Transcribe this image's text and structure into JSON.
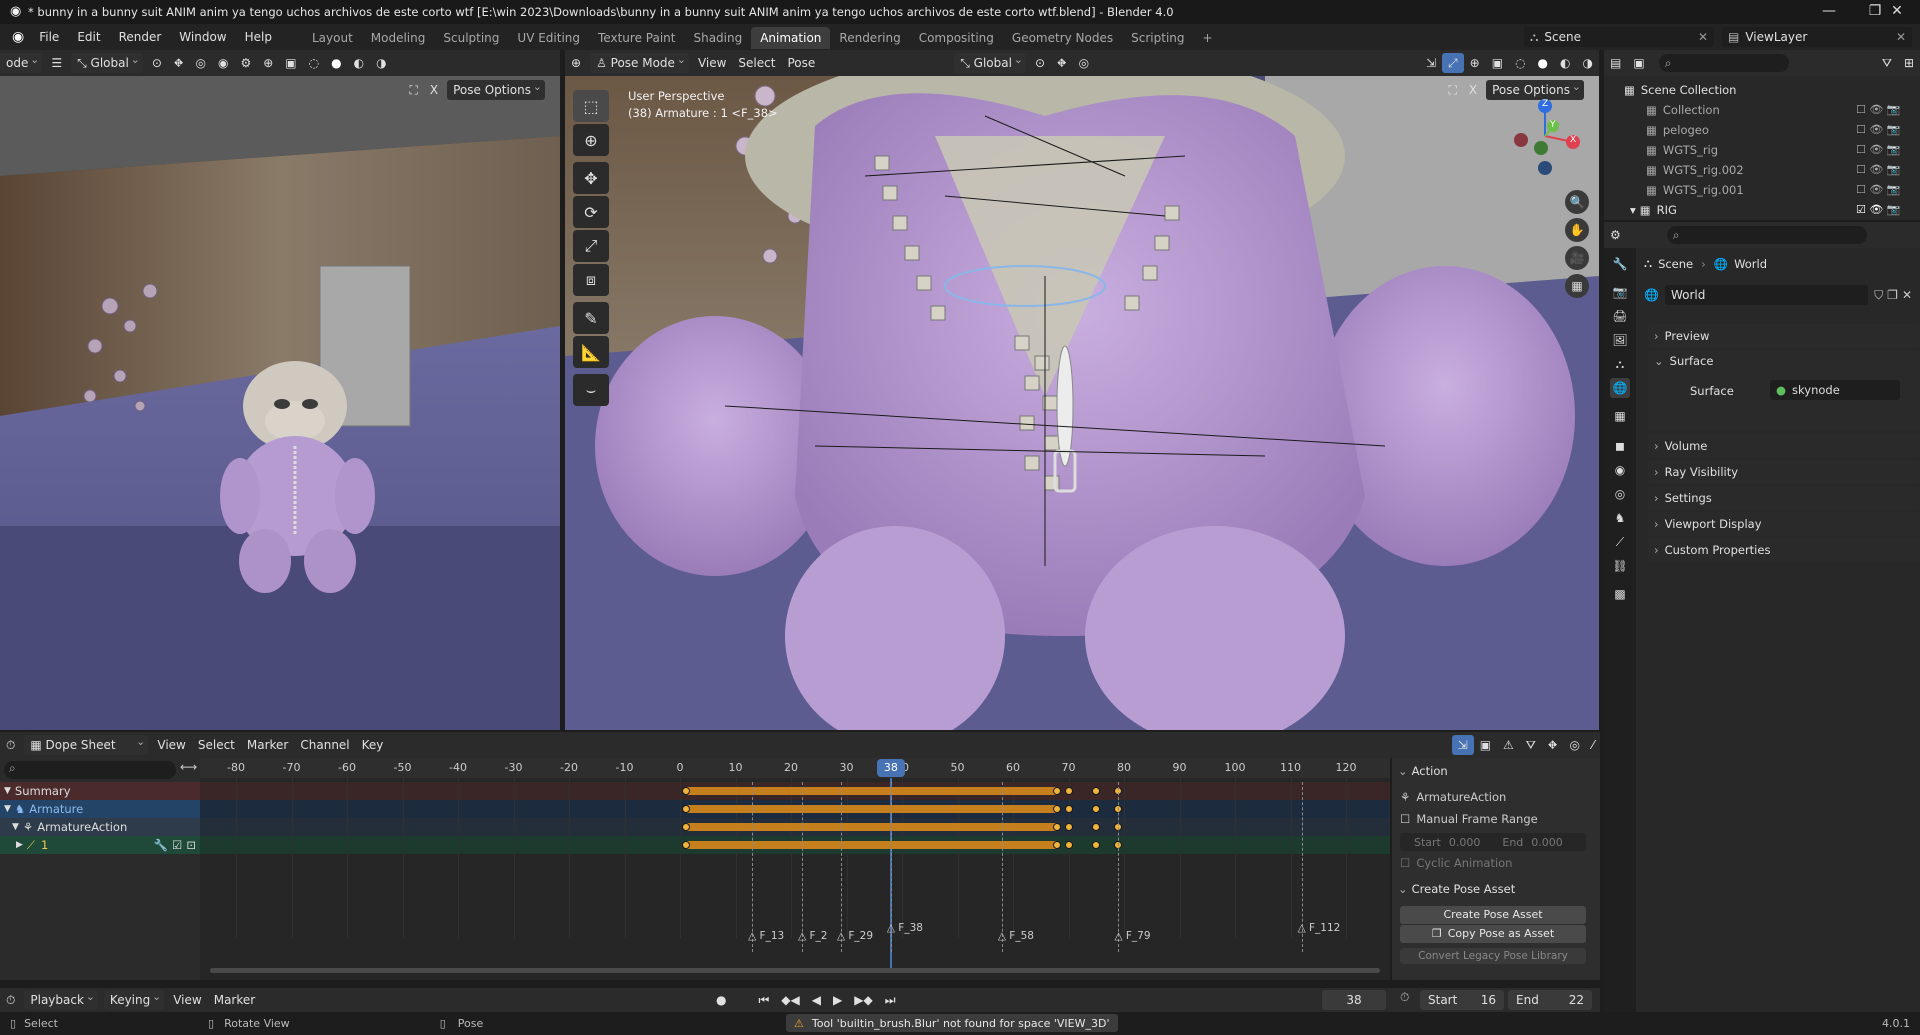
{
  "window": {
    "title": "* bunny in a bunny suit ANIM anim ya tengo uchos archivos de este corto wtf [E:\\win 2023\\Downloads\\bunny in a bunny suit ANIM anim ya tengo uchos archivos de este corto wtf.blend] - Blender 4.0",
    "minimize": "—",
    "restore": "❐",
    "close": "✕"
  },
  "menus": [
    "File",
    "Edit",
    "Render",
    "Window",
    "Help"
  ],
  "workspaces": [
    "Layout",
    "Modeling",
    "Sculpting",
    "UV Editing",
    "Texture Paint",
    "Shading",
    "Animation",
    "Rendering",
    "Compositing",
    "Geometry Nodes",
    "Scripting"
  ],
  "active_workspace": "Animation",
  "add_workspace": "+",
  "scene_selector": "Scene",
  "viewlayer_selector": "ViewLayer",
  "left_viewport": {
    "mode_label": "ode",
    "orientation": "Global",
    "pose_options": "Pose Options"
  },
  "main_viewport": {
    "mode": "Pose Mode",
    "menus": [
      "View",
      "Select",
      "Pose"
    ],
    "orientation": "Global",
    "pose_options": "Pose Options",
    "overlay_line1": "User Perspective",
    "overlay_line2": "(38) Armature : 1 <F_38>",
    "gizmo_axes": [
      "X",
      "Y",
      "Z"
    ]
  },
  "outliner": {
    "root": "Scene Collection",
    "items": [
      "Collection",
      "pelogeo",
      "WGTS_rig",
      "WGTS_rig.002",
      "WGTS_rig.001",
      "RIG"
    ]
  },
  "properties": {
    "breadcrumb_scene": "Scene",
    "breadcrumb_world": "World",
    "datablock": "World",
    "panels": [
      "Preview",
      "Surface",
      "Volume",
      "Ray Visibility",
      "Settings",
      "Viewport Display",
      "Custom Properties"
    ],
    "surface_label": "Surface",
    "surface_value": "skynode"
  },
  "dopesheet": {
    "editor": "Dope Sheet",
    "menus": [
      "View",
      "Select",
      "Marker",
      "Channel",
      "Key"
    ],
    "ticks": [
      -80,
      -70,
      -60,
      -50,
      -40,
      -30,
      -20,
      -10,
      0,
      10,
      20,
      30,
      40,
      50,
      60,
      70,
      80,
      90,
      100,
      110,
      120
    ],
    "current_frame": "38",
    "channels": [
      "Summary",
      "Armature",
      "ArmatureAction",
      "1"
    ],
    "markers": [
      "F_13",
      "F_2",
      "F_29",
      "F_38",
      "F_58",
      "F_79",
      "F_112"
    ],
    "keyframes": [
      1,
      68,
      70,
      75,
      79
    ],
    "side_panel": {
      "action_header": "Action",
      "action_name": "ArmatureAction",
      "manual_frame_range": "Manual Frame Range",
      "start_label": "Start",
      "start_value": "0.000",
      "end_label": "End",
      "end_value": "0.000",
      "cyclic": "Cyclic Animation",
      "pose_header": "Create Pose Asset",
      "create_pose_asset": "Create Pose Asset",
      "copy_pose_as_asset": "Copy Pose as Asset",
      "convert_legacy": "Convert Legacy Pose Library"
    }
  },
  "timeline": {
    "menus": [
      "Playback",
      "Keying",
      "View",
      "Marker"
    ],
    "current_frame": "38",
    "start_label": "Start",
    "start_value": "16",
    "end_label": "End",
    "end_value": "22"
  },
  "statusbar": {
    "select": "Select",
    "rotate_view": "Rotate View",
    "pose": "Pose",
    "warning": "Tool 'builtin_brush.Blur' not found for space 'VIEW_3D'",
    "version": "4.0.1"
  },
  "colors": {
    "accent_blue": "#4772b3",
    "keyframe": "#f0b43c",
    "summary_row": "#4a2a2a",
    "armature_row": "#234466",
    "bone_row": "#1f4a3a"
  }
}
